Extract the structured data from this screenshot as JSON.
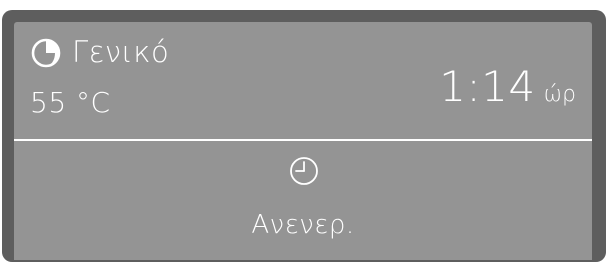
{
  "program": {
    "icon": "half-moon-icon",
    "name": "Γενικό",
    "temperature": "55 °C"
  },
  "duration": {
    "value": "1:14",
    "unit": "ώρ"
  },
  "delay_start": {
    "icon": "clock-icon",
    "status": "Ανενερ."
  },
  "colors": {
    "bezel": "#5e5e5e",
    "screen": "#949494",
    "text": "#ffffff"
  }
}
